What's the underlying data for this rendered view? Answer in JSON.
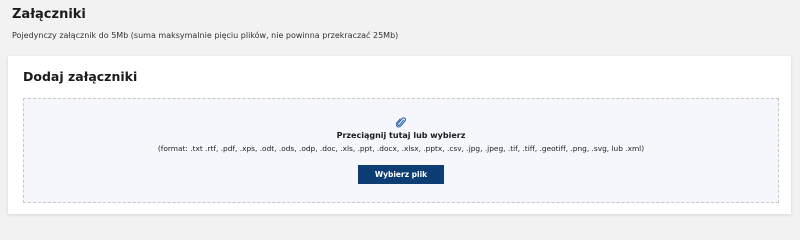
{
  "section": {
    "title": "Załączniki",
    "description": "Pojedynczy załącznik do 5Mb (suma maksymalnie pięciu plików, nie powinna przekraczać 25Mb)"
  },
  "card": {
    "title": "Dodaj załączniki"
  },
  "dropzone": {
    "icon": "paperclip-icon",
    "title": "Przeciągnij tutaj lub wybierz",
    "formats": "(format: .txt .rtf, .pdf, .xps, .odt, .ods, .odp, .doc, .xls, .ppt, .docx, .xlsx, .pptx, .csv, .jpg, .jpeg, .tif, .tiff, .geotiff, .png, .svg, lub .xml)",
    "button_label": "Wybierz plik"
  },
  "colors": {
    "page_background": "#f2f2f2",
    "dropzone_background": "#f5f7fc",
    "button": "#0d3e73",
    "icon": "#1f5ca6"
  }
}
